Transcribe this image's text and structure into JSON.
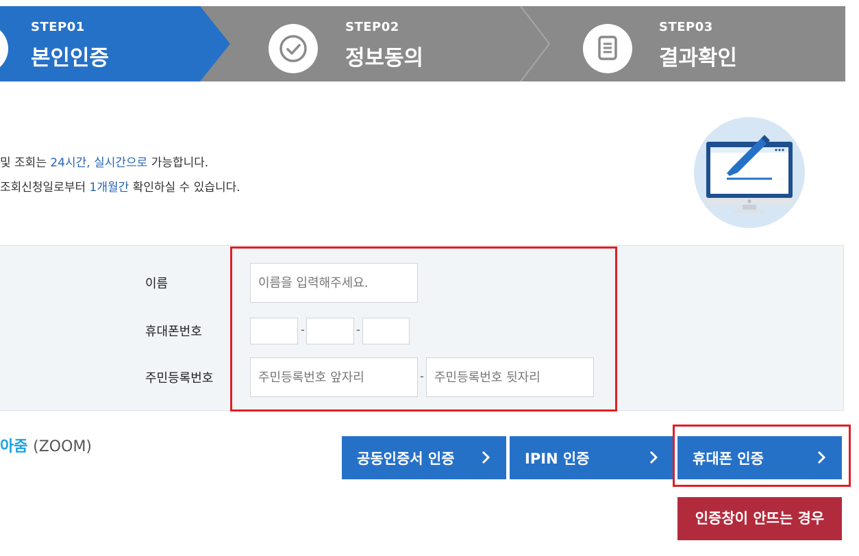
{
  "steps": [
    {
      "number": "STEP01",
      "title": "본인인증",
      "icon": "unknown-icon"
    },
    {
      "number": "STEP02",
      "title": "정보동의",
      "icon": "check-circle-icon"
    },
    {
      "number": "STEP03",
      "title": "결과확인",
      "icon": "document-icon"
    }
  ],
  "info": {
    "line1_pre": "및 조회는 ",
    "line1_hl": "24시간, 실시간으로",
    "line1_post": " 가능합니다.",
    "line2_pre": "조회신청일로부터 ",
    "line2_hl": "1개월간",
    "line2_post": " 확인하실 수 있습니다."
  },
  "form": {
    "name_label": "이름",
    "name_placeholder": "이름을 입력해주세요.",
    "phone_label": "휴대폰번호",
    "phone_sep": "-",
    "rrn_label": "주민등록번호",
    "rrn_front_placeholder": "주민등록번호 앞자리",
    "rrn_sep": "-",
    "rrn_back_placeholder": "주민등록번호 뒷자리"
  },
  "zoom": {
    "brand": "아줌",
    "suffix": "(ZOOM)"
  },
  "buttons": {
    "cert_label": "공동인증서 인증",
    "ipin_label": "IPIN 인증",
    "phone_label": "휴대폰 인증",
    "help_label": "인증창이 안뜨는 경우"
  },
  "colors": {
    "accent_blue": "#2671c8",
    "step_gray": "#8a8a8a",
    "highlight_red": "#e01e25",
    "help_red": "#b22b3c",
    "text_highlight": "#2465b4",
    "zoom_cyan": "#1aa3e0"
  }
}
